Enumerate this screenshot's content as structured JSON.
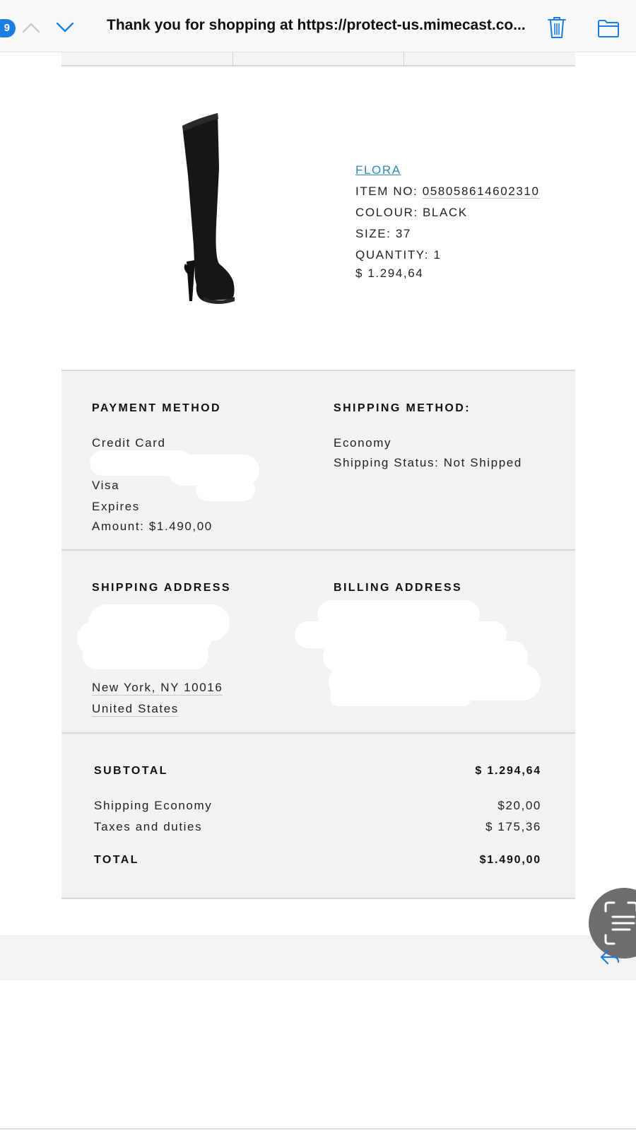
{
  "header": {
    "unread_count": "9",
    "subject": "Thank you for shopping at https://protect-us.mimecast.co..."
  },
  "product": {
    "name": "FLORA",
    "item_no_label": "ITEM NO:",
    "item_no": "058058614602310",
    "colour": "COLOUR: BLACK",
    "size": "SIZE: 37",
    "quantity": "QUANTITY: 1",
    "price": "$ 1.294,64"
  },
  "payment": {
    "heading": "PAYMENT METHOD",
    "method": "Credit Card",
    "card": "Visa",
    "expires": "Expires",
    "amount": "Amount: $1.490,00"
  },
  "shipping_method": {
    "heading": "SHIPPING METHOD:",
    "method": "Economy",
    "status": "Shipping Status: Not Shipped"
  },
  "shipping_address": {
    "heading": "SHIPPING ADDRESS",
    "city_line": "New York,  NY  10016",
    "country": "United States"
  },
  "billing_address": {
    "heading": "BILLING ADDRESS"
  },
  "totals": {
    "subtotal_label": "SUBTOTAL",
    "subtotal_value": "$ 1.294,64",
    "shipping_label": "Shipping Economy",
    "shipping_value": "$20,00",
    "taxes_label": "Taxes and duties",
    "taxes_value": "$ 175,36",
    "total_label": "TOTAL",
    "total_value": "$1.490,00"
  },
  "colors": {
    "accent": "#1a7ddf",
    "link": "#2b8cb4",
    "panel_bg": "#f2f2f2"
  },
  "icons": [
    "chevron-up-icon",
    "chevron-down-icon",
    "trash-icon",
    "folder-icon",
    "scan-text-icon",
    "reply-icon"
  ]
}
